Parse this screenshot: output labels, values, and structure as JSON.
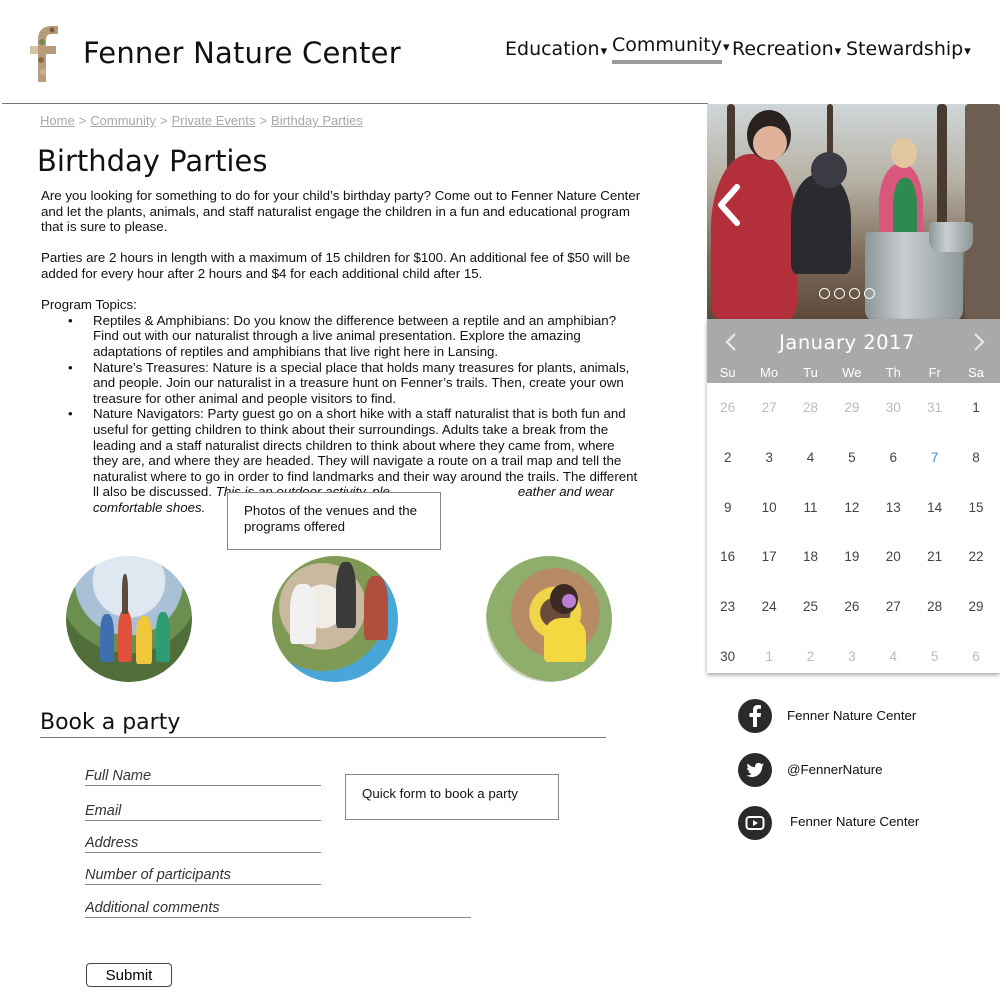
{
  "site": {
    "title": "Fenner Nature Center"
  },
  "nav": {
    "items": [
      {
        "label": "Education",
        "caret": "▾"
      },
      {
        "label": "Community",
        "caret": "▾"
      },
      {
        "label": "Recreation",
        "caret": "▾"
      },
      {
        "label": "Stewardship",
        "caret": "▾"
      }
    ],
    "active": "Community"
  },
  "breadcrumb": [
    "Home",
    "Community",
    "Private Events",
    "Birthday Parties"
  ],
  "page": {
    "title": "Birthday Parties",
    "intro": "Are you looking for something to do for your child’s birthday party? Come out to Fenner Nature Center and let the plants, animals, and staff naturalist engage the children in a fun and educational program that is sure to please.",
    "pricing": "Parties are 2 hours in length with a maximum of 15 children for $100. An additional fee of $50 will be added for every hour after 2 hours and $4 for each additional child after 15.",
    "topics_label": "Program Topics:",
    "topics": [
      "Reptiles & Amphibians: Do you know the difference between a reptile and an amphibian? Find out with our naturalist through a live animal presentation. Explore the amazing adaptations of reptiles and amphibians that live right here in Lansing.",
      "Nature’s Treasures: Nature is a special place that holds many treasures for plants, animals, and people. Join our naturalist in a treasure hunt on Fenner’s trails. Then, create your own treasure for other animal and people visitors to find.",
      "Nature Navigators: Party guest go on a short hike with a staff naturalist that is both fun and useful for getting children to think about their surroundings. Adults take a break from the leading and a staff naturalist directs children to think about where they came from, where they are, and where they are headed. They will navigate a route on a trail map and tell the naturalist where to go in order to find landmarks and their way around the trails. The different"
    ],
    "topic3_tail_plain": " ll also be discussed. ",
    "topic3_italic": "This is an outdoor activity, ple",
    "topic3_italic_tail": "eather and wear comfortable shoes."
  },
  "notes": {
    "photos": "Photos of the venues and the programs offered",
    "form": "Quick form to book a party"
  },
  "booking": {
    "title": "Book a party",
    "fields": [
      {
        "placeholder": "Full Name"
      },
      {
        "placeholder": "Email"
      },
      {
        "placeholder": "Address"
      },
      {
        "placeholder": "Number of participants"
      },
      {
        "placeholder": "Additional comments"
      }
    ],
    "submit_label": "Submit"
  },
  "carousel": {
    "slide_count": 4,
    "active_index": 0
  },
  "calendar": {
    "month_label": "January 2017",
    "weekdays": [
      "Su",
      "Mo",
      "Tu",
      "We",
      "Th",
      "Fr",
      "Sa"
    ],
    "weeks": [
      [
        {
          "d": "26",
          "m": true
        },
        {
          "d": "27",
          "m": true
        },
        {
          "d": "28",
          "m": true
        },
        {
          "d": "29",
          "m": true
        },
        {
          "d": "30",
          "m": true
        },
        {
          "d": "31",
          "m": true
        },
        {
          "d": "1"
        }
      ],
      [
        {
          "d": "2"
        },
        {
          "d": "3"
        },
        {
          "d": "4"
        },
        {
          "d": "5"
        },
        {
          "d": "6"
        },
        {
          "d": "7",
          "t": true
        },
        {
          "d": "8"
        }
      ],
      [
        {
          "d": "9"
        },
        {
          "d": "10"
        },
        {
          "d": "11"
        },
        {
          "d": "12"
        },
        {
          "d": "13"
        },
        {
          "d": "14"
        },
        {
          "d": "15"
        }
      ],
      [
        {
          "d": "16"
        },
        {
          "d": "17"
        },
        {
          "d": "18"
        },
        {
          "d": "19"
        },
        {
          "d": "20"
        },
        {
          "d": "21"
        },
        {
          "d": "22"
        }
      ],
      [
        {
          "d": "23"
        },
        {
          "d": "24"
        },
        {
          "d": "25"
        },
        {
          "d": "26"
        },
        {
          "d": "27"
        },
        {
          "d": "28"
        },
        {
          "d": "29"
        }
      ],
      [
        {
          "d": "30"
        },
        {
          "d": "1",
          "m": true
        },
        {
          "d": "2",
          "m": true
        },
        {
          "d": "3",
          "m": true
        },
        {
          "d": "4",
          "m": true
        },
        {
          "d": "5",
          "m": true
        },
        {
          "d": "6",
          "m": true
        }
      ]
    ],
    "highlight_color": "#3b8fd4"
  },
  "social": [
    {
      "icon": "facebook-icon",
      "label": "Fenner Nature Center"
    },
    {
      "icon": "twitter-icon",
      "label": "@FennerNature"
    },
    {
      "icon": "youtube-icon",
      "label": "Fenner Nature Center"
    }
  ]
}
